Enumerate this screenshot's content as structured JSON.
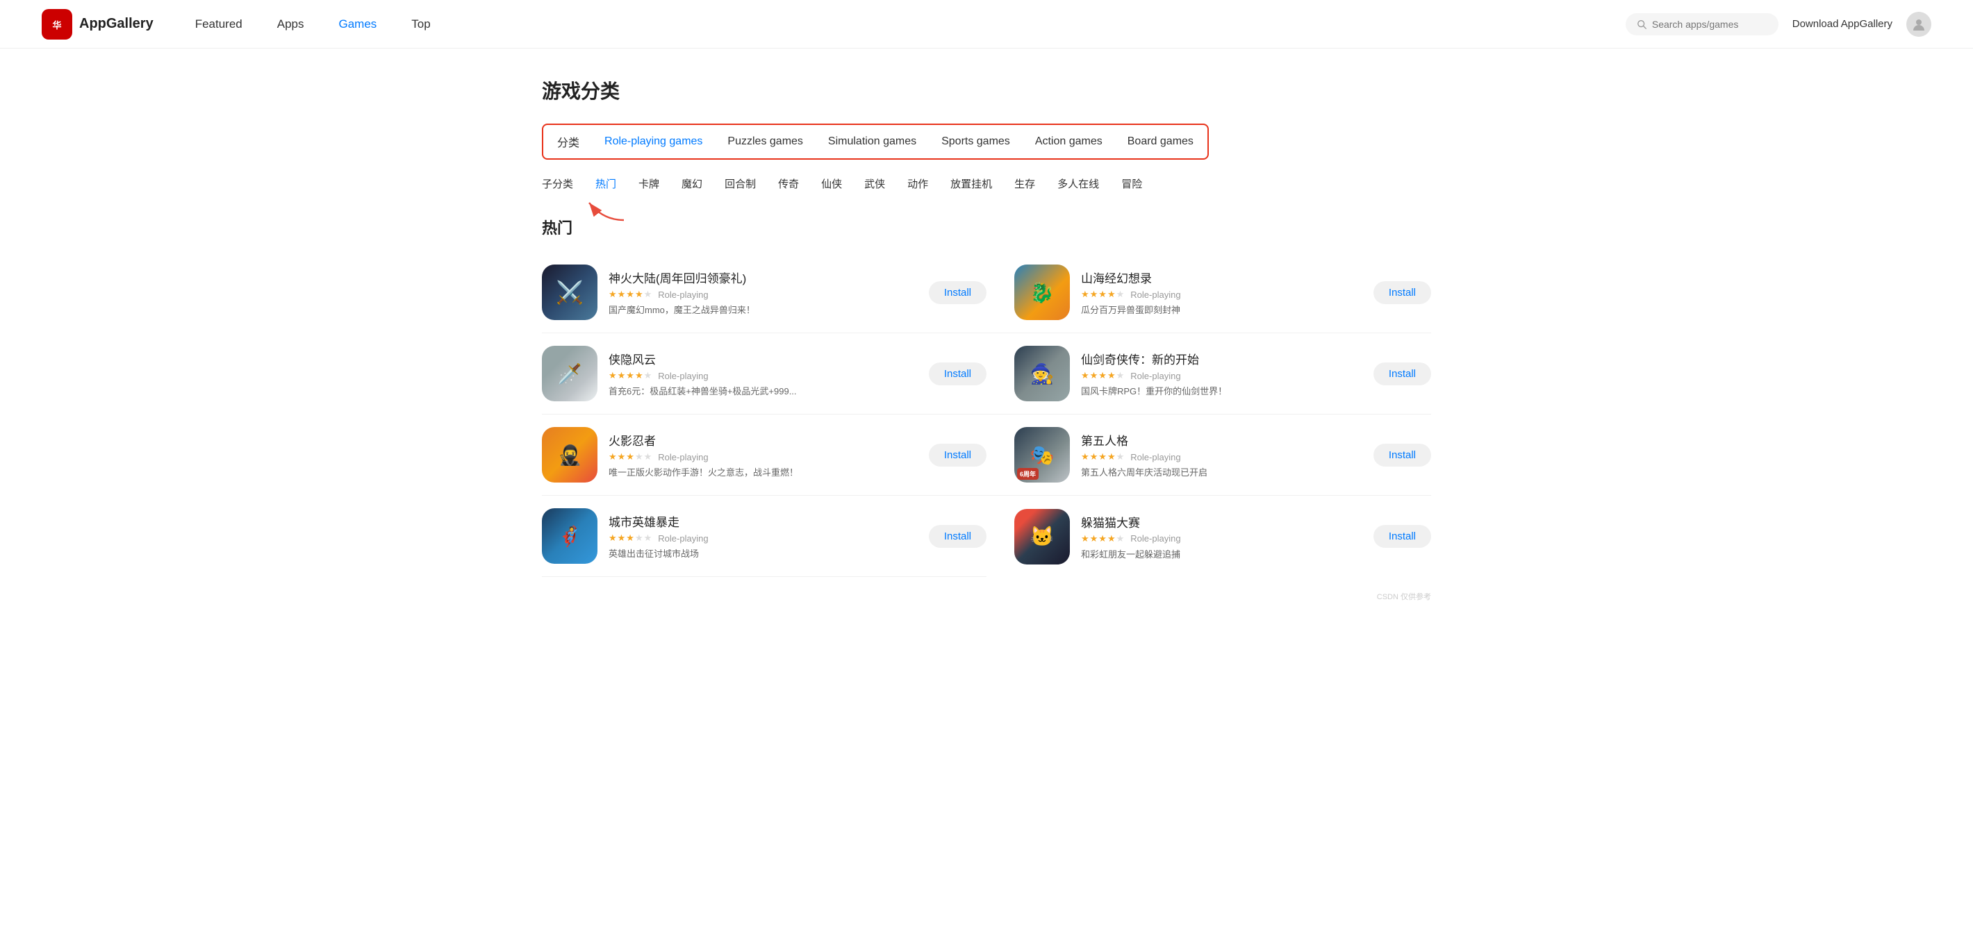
{
  "header": {
    "logo_text": "AppGallery",
    "nav": [
      {
        "label": "Featured",
        "active": false
      },
      {
        "label": "Apps",
        "active": false
      },
      {
        "label": "Games",
        "active": true
      },
      {
        "label": "Top",
        "active": false
      }
    ],
    "search_placeholder": "Search apps/games",
    "download_label": "Download AppGallery"
  },
  "page": {
    "section_title": "游戏分类",
    "category_label": "分类",
    "categories": [
      {
        "label": "Role-playing games",
        "active": true
      },
      {
        "label": "Puzzles games",
        "active": false
      },
      {
        "label": "Simulation games",
        "active": false
      },
      {
        "label": "Sports games",
        "active": false
      },
      {
        "label": "Action games",
        "active": false
      },
      {
        "label": "Board games",
        "active": false
      }
    ],
    "subcategory_label": "子分类",
    "subcategories": [
      {
        "label": "热门",
        "active": true
      },
      {
        "label": "卡牌",
        "active": false
      },
      {
        "label": "魔幻",
        "active": false
      },
      {
        "label": "回合制",
        "active": false
      },
      {
        "label": "传奇",
        "active": false
      },
      {
        "label": "仙侠",
        "active": false
      },
      {
        "label": "武侠",
        "active": false
      },
      {
        "label": "动作",
        "active": false
      },
      {
        "label": "放置挂机",
        "active": false
      },
      {
        "label": "生存",
        "active": false
      },
      {
        "label": "多人在线",
        "active": false
      },
      {
        "label": "冒险",
        "active": false
      }
    ],
    "hot_title": "热门",
    "games": [
      {
        "id": 1,
        "name": "神火大陆(周年回归领豪礼)",
        "stars": 4,
        "genre": "Role-playing",
        "desc": "国产魔幻mmo，魔王之战异兽归来！",
        "icon_class": "icon-1",
        "icon_emoji": "⚔️"
      },
      {
        "id": 2,
        "name": "山海经幻想录",
        "stars": 4,
        "genre": "Role-playing",
        "desc": "瓜分百万异兽蛋即刻封神",
        "icon_class": "icon-2",
        "icon_emoji": "🐉"
      },
      {
        "id": 3,
        "name": "侠隐风云",
        "stars": 4,
        "genre": "Role-playing",
        "desc": "首充6元：极品红装+神兽坐骑+极品光武+999...",
        "icon_class": "icon-3",
        "icon_emoji": "🗡️"
      },
      {
        "id": 4,
        "name": "仙剑奇侠传：新的开始",
        "stars": 3.5,
        "genre": "Role-playing",
        "desc": "国风卡牌RPG！重开你的仙剑世界！",
        "icon_class": "icon-4",
        "icon_emoji": "🧙"
      },
      {
        "id": 5,
        "name": "火影忍者",
        "stars": 3,
        "genre": "Role-playing",
        "desc": "唯一正版火影动作手游！火之意志，战斗重燃！",
        "icon_class": "icon-5",
        "icon_emoji": "🥷"
      },
      {
        "id": 6,
        "name": "第五人格",
        "stars": 4,
        "genre": "Role-playing",
        "desc": "第五人格六周年庆活动现已开启",
        "icon_class": "icon-6",
        "icon_emoji": "🎭",
        "badge": "6周年"
      },
      {
        "id": 7,
        "name": "城市英雄暴走",
        "stars": 3,
        "genre": "Role-playing",
        "desc": "英雄出击征讨城市战场",
        "icon_class": "icon-7",
        "icon_emoji": "🦸"
      },
      {
        "id": 8,
        "name": "躲猫猫大赛",
        "stars": 4,
        "genre": "Role-playing",
        "desc": "和彩虹朋友一起躲避追捕",
        "icon_class": "icon-8",
        "icon_emoji": "🐱"
      }
    ]
  }
}
